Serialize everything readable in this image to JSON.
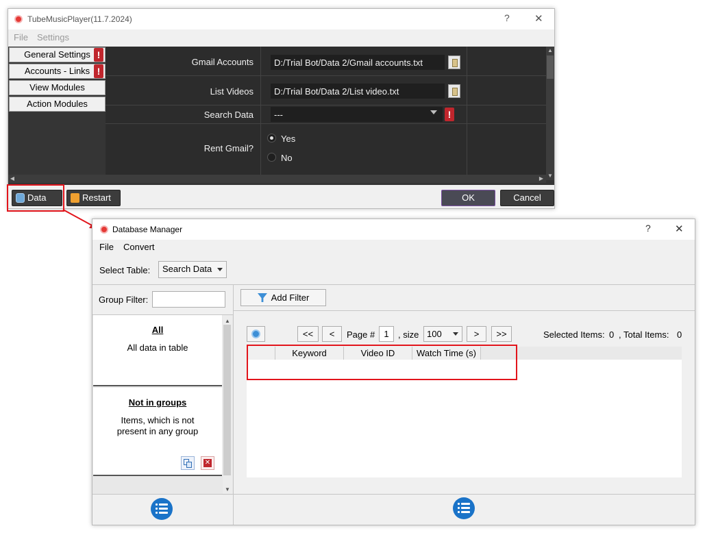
{
  "main": {
    "title": "TubeMusicPlayer(11.7.2024)",
    "help_glyph": "?",
    "close_glyph": "✕",
    "menu": [
      "File",
      "Settings"
    ],
    "sidebar": [
      {
        "label": "General Settings",
        "warning": "!"
      },
      {
        "label": "Accounts - Links",
        "warning": "!"
      },
      {
        "label": "View Modules"
      },
      {
        "label": "Action Modules"
      }
    ],
    "properties": {
      "gmail_label": "Gmail Accounts",
      "gmail_value": "D:/Trial Bot/Data 2/Gmail accounts.txt",
      "list_label": "List Videos",
      "list_value": "D:/Trial Bot/Data 2/List video.txt",
      "search_label": "Search Data",
      "search_value": "---",
      "search_warning": "!",
      "rent_label": "Rent Gmail?",
      "rent_yes": "Yes",
      "rent_no": "No",
      "rent_selected": "Yes"
    },
    "bottom": {
      "data_label": "Data",
      "restart_label": "Restart",
      "ok_label": "OK",
      "cancel_label": "Cancel"
    }
  },
  "db": {
    "title": "Database Manager",
    "help_glyph": "?",
    "close_glyph": "✕",
    "menu": [
      "File",
      "Convert"
    ],
    "select_table_label": "Select Table:",
    "select_table_value": "Search Data",
    "group_filter_label": "Group Filter:",
    "group_filter_value": "",
    "groups": [
      {
        "title": "All",
        "desc": "All data in table"
      },
      {
        "title": "Not in groups",
        "desc_line1": "Items, which is not",
        "desc_line2": "present in any group"
      }
    ],
    "add_filter_label": "Add Filter",
    "pager": {
      "first": "<<",
      "prev": "<",
      "page_label": "Page #",
      "page_value": "1",
      "size_label": ", size",
      "size_value": "100",
      "next": ">",
      "last": ">>"
    },
    "selected_items_label": "Selected Items:",
    "selected_items_value": "0",
    "total_items_label": ", Total Items:",
    "total_items_value": "0",
    "columns": [
      "Keyword",
      "Video ID",
      "Watch Time (s)"
    ]
  },
  "colors": {
    "highlight": "#e2141b",
    "accent_blue": "#1a73c8",
    "warning_red": "#c0262d"
  }
}
